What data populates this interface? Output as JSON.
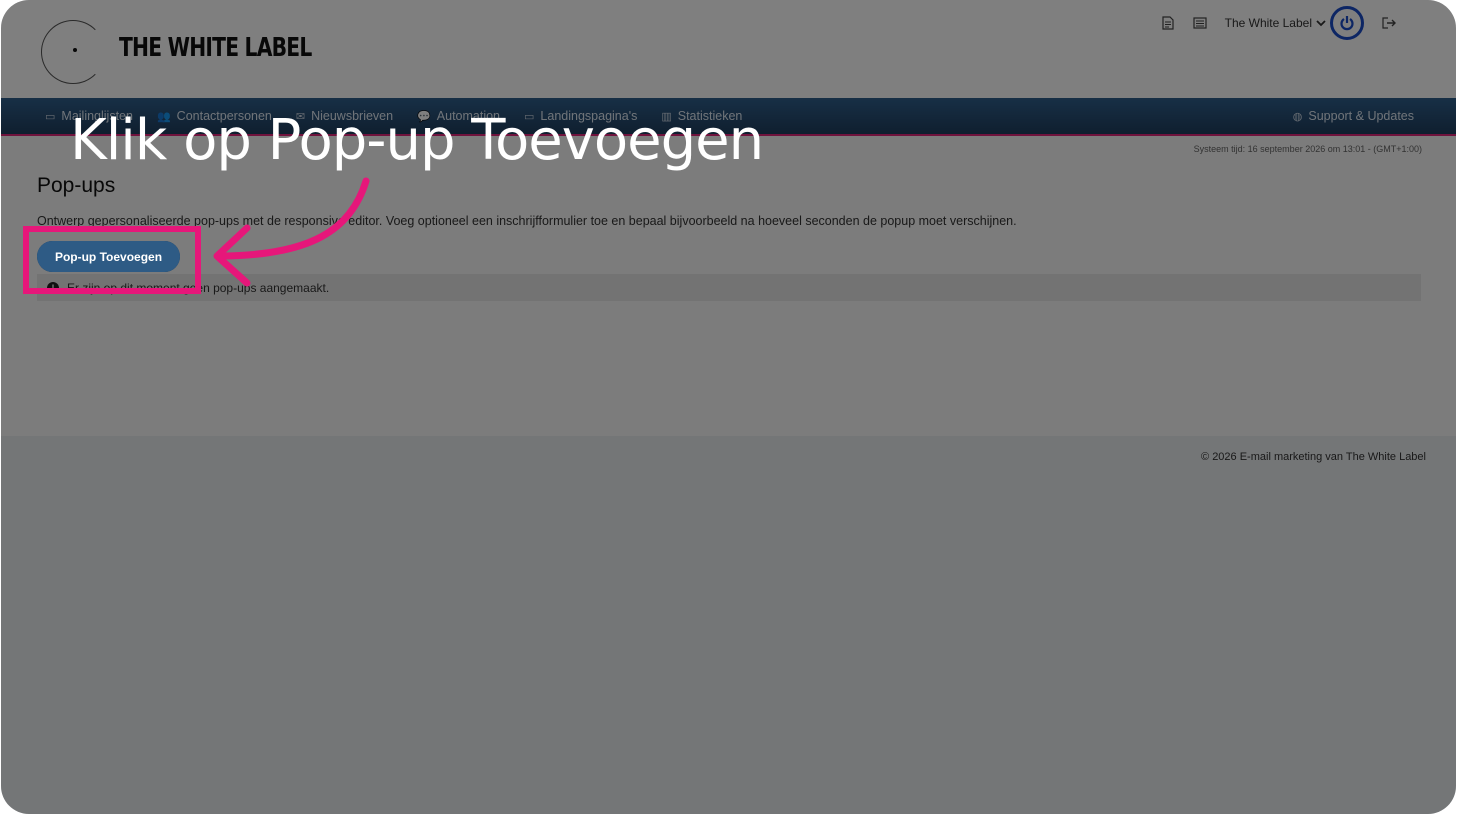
{
  "header": {
    "logo_text": "THE WHITE LABEL",
    "account_name": "The White Label"
  },
  "nav": {
    "items": [
      {
        "label": "Mailinglijsten",
        "icon": "folder-icon"
      },
      {
        "label": "Contactpersonen",
        "icon": "users-icon"
      },
      {
        "label": "Nieuwsbrieven",
        "icon": "envelope-icon"
      },
      {
        "label": "Automation",
        "icon": "chat-icon"
      },
      {
        "label": "Landingspagina's",
        "icon": "monitor-icon"
      },
      {
        "label": "Statistieken",
        "icon": "chart-icon"
      }
    ],
    "support_label": "Support & Updates"
  },
  "page": {
    "system_time": "Systeem tijd: 16 september 2026 om 13:01 - (GMT+1:00)",
    "title": "Pop-ups",
    "description": "Ontwerp gepersonaliseerde pop-ups met de responsive editor. Voeg optioneel een inschrijfformulier toe en bepaal bijvoorbeeld na hoeveel seconden de popup moet verschijnen.",
    "add_button": "Pop-up Toevoegen",
    "empty_message": "Er zijn op dit moment geen pop-ups aangemaakt."
  },
  "footer": {
    "text": "© 2026 E-mail marketing van The White Label"
  },
  "overlay": {
    "callout": "Klik op Pop-up Toevoegen",
    "highlight_color": "#e6177a"
  }
}
